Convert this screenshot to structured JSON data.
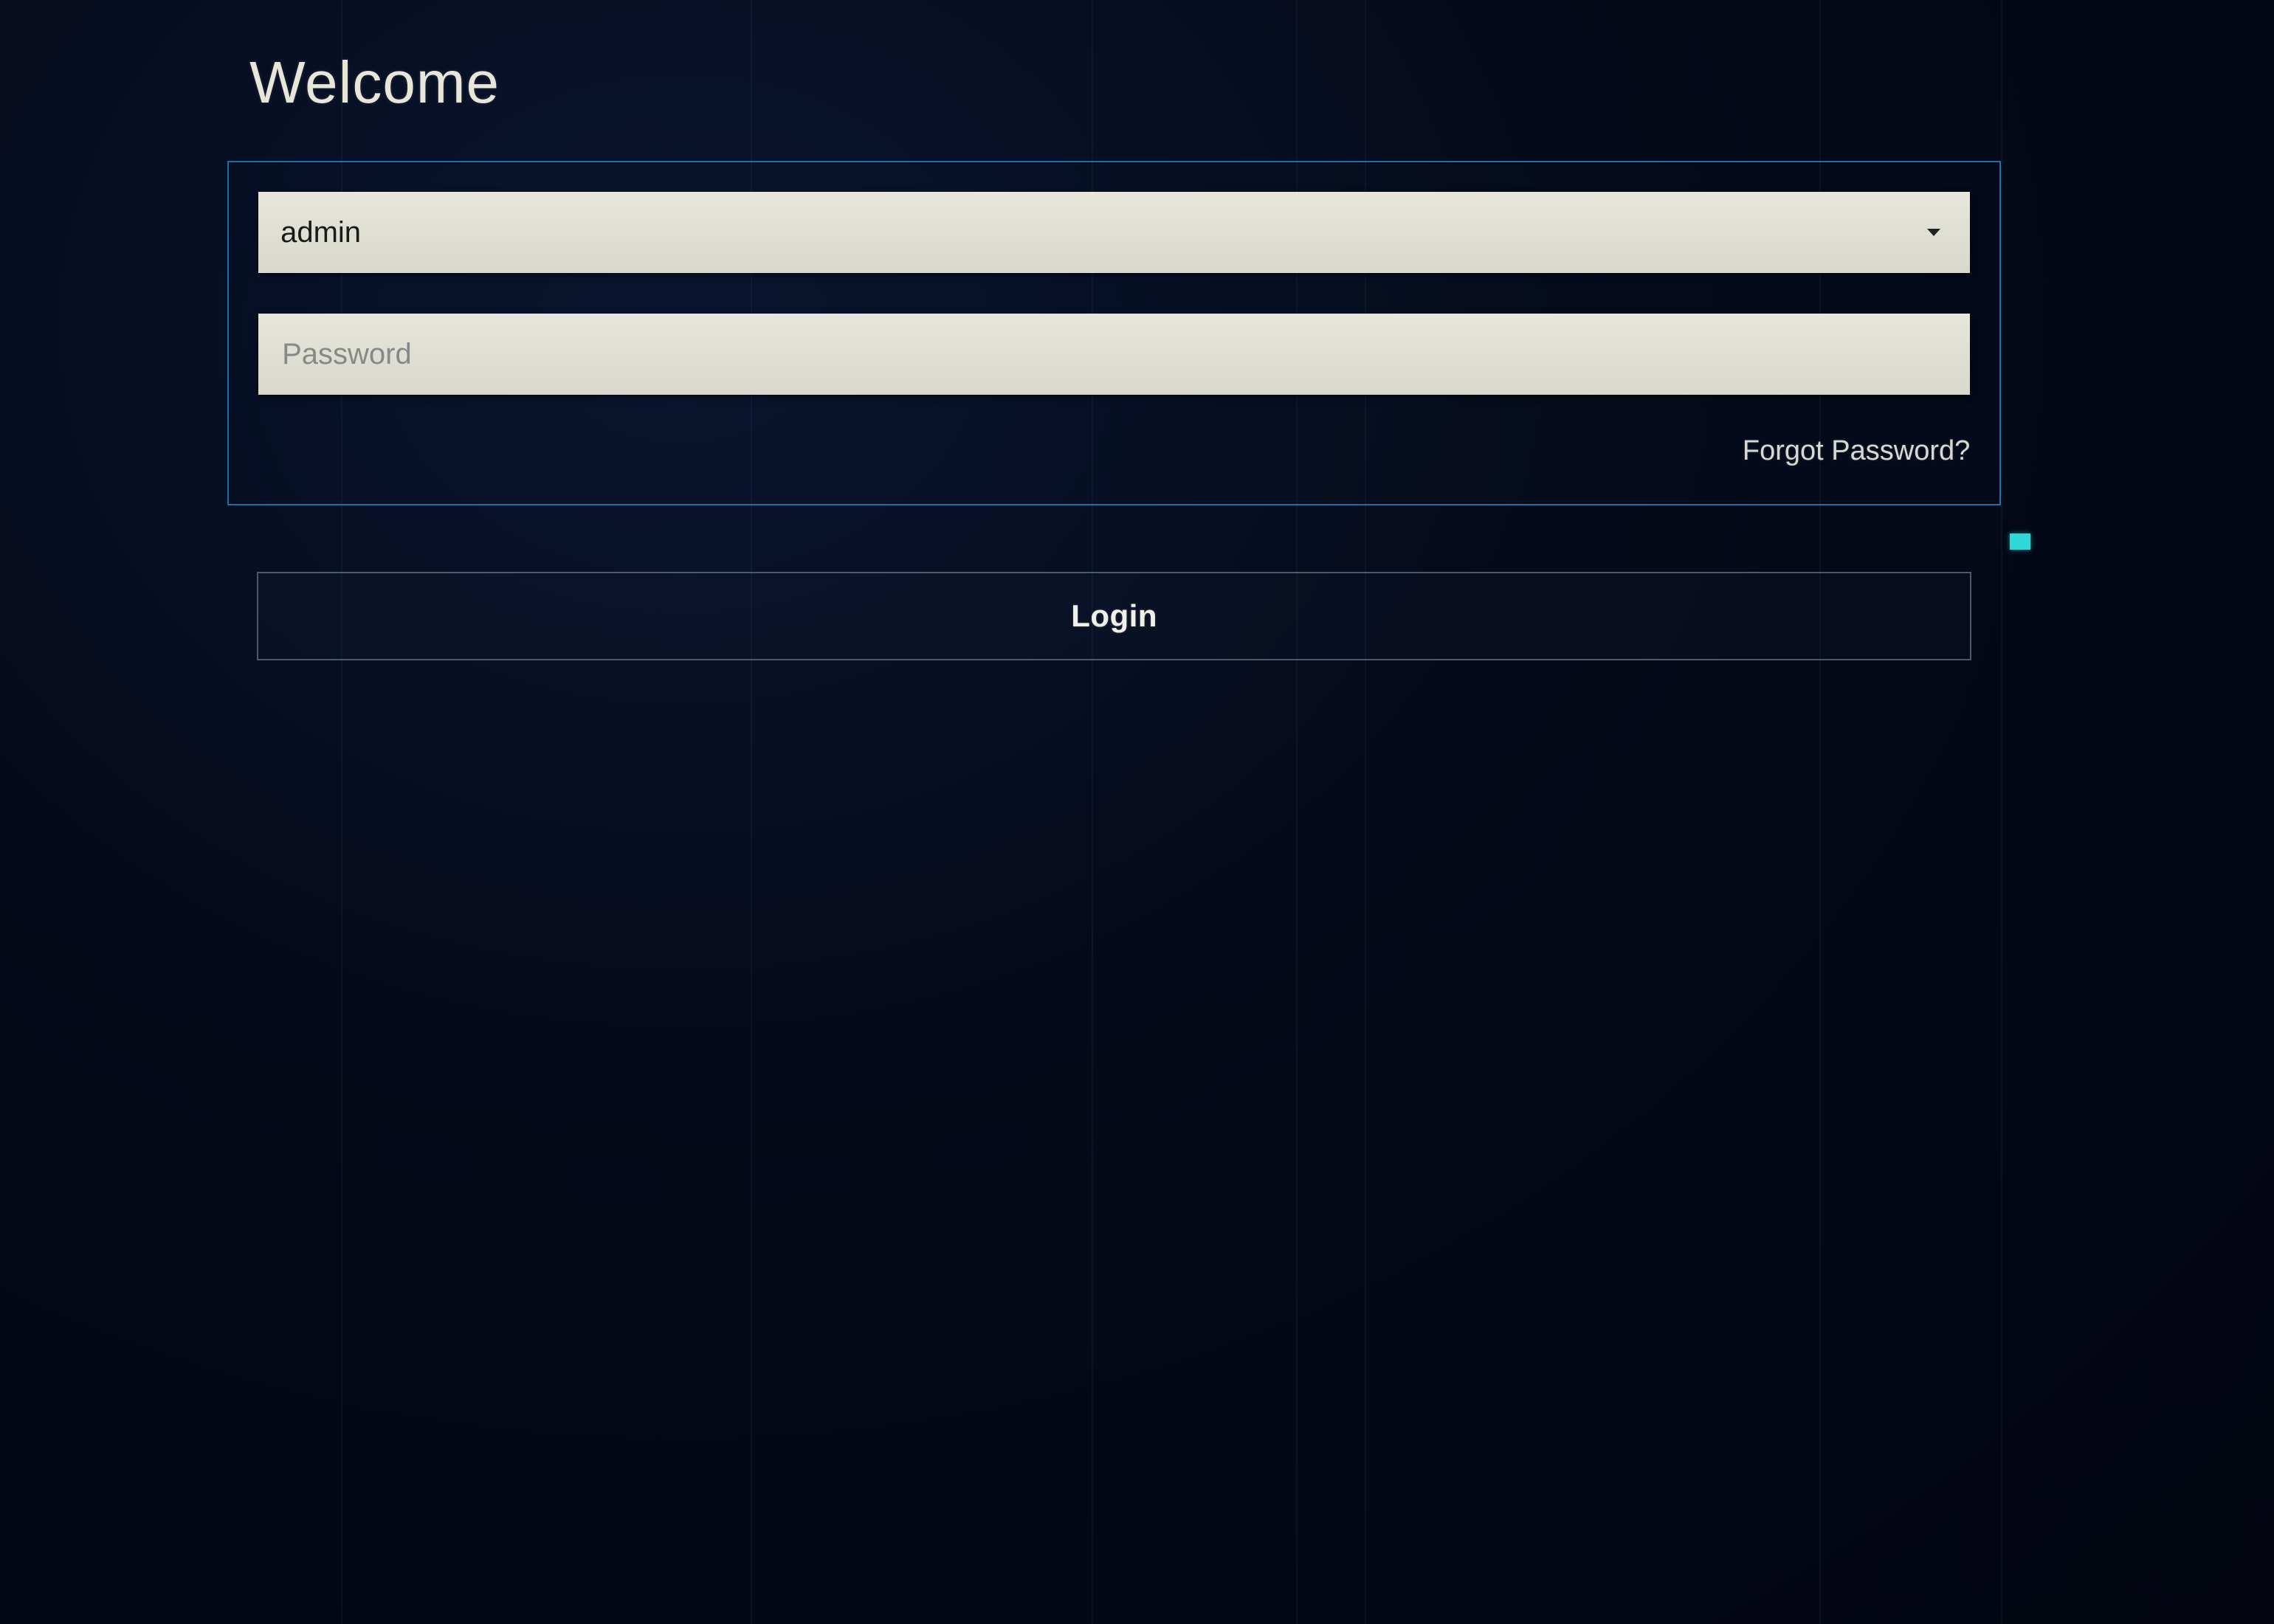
{
  "title": "Welcome",
  "form": {
    "username": {
      "value": "admin"
    },
    "password": {
      "value": "",
      "placeholder": "Password"
    },
    "forgot_label": "Forgot Password?"
  },
  "login_button_label": "Login"
}
